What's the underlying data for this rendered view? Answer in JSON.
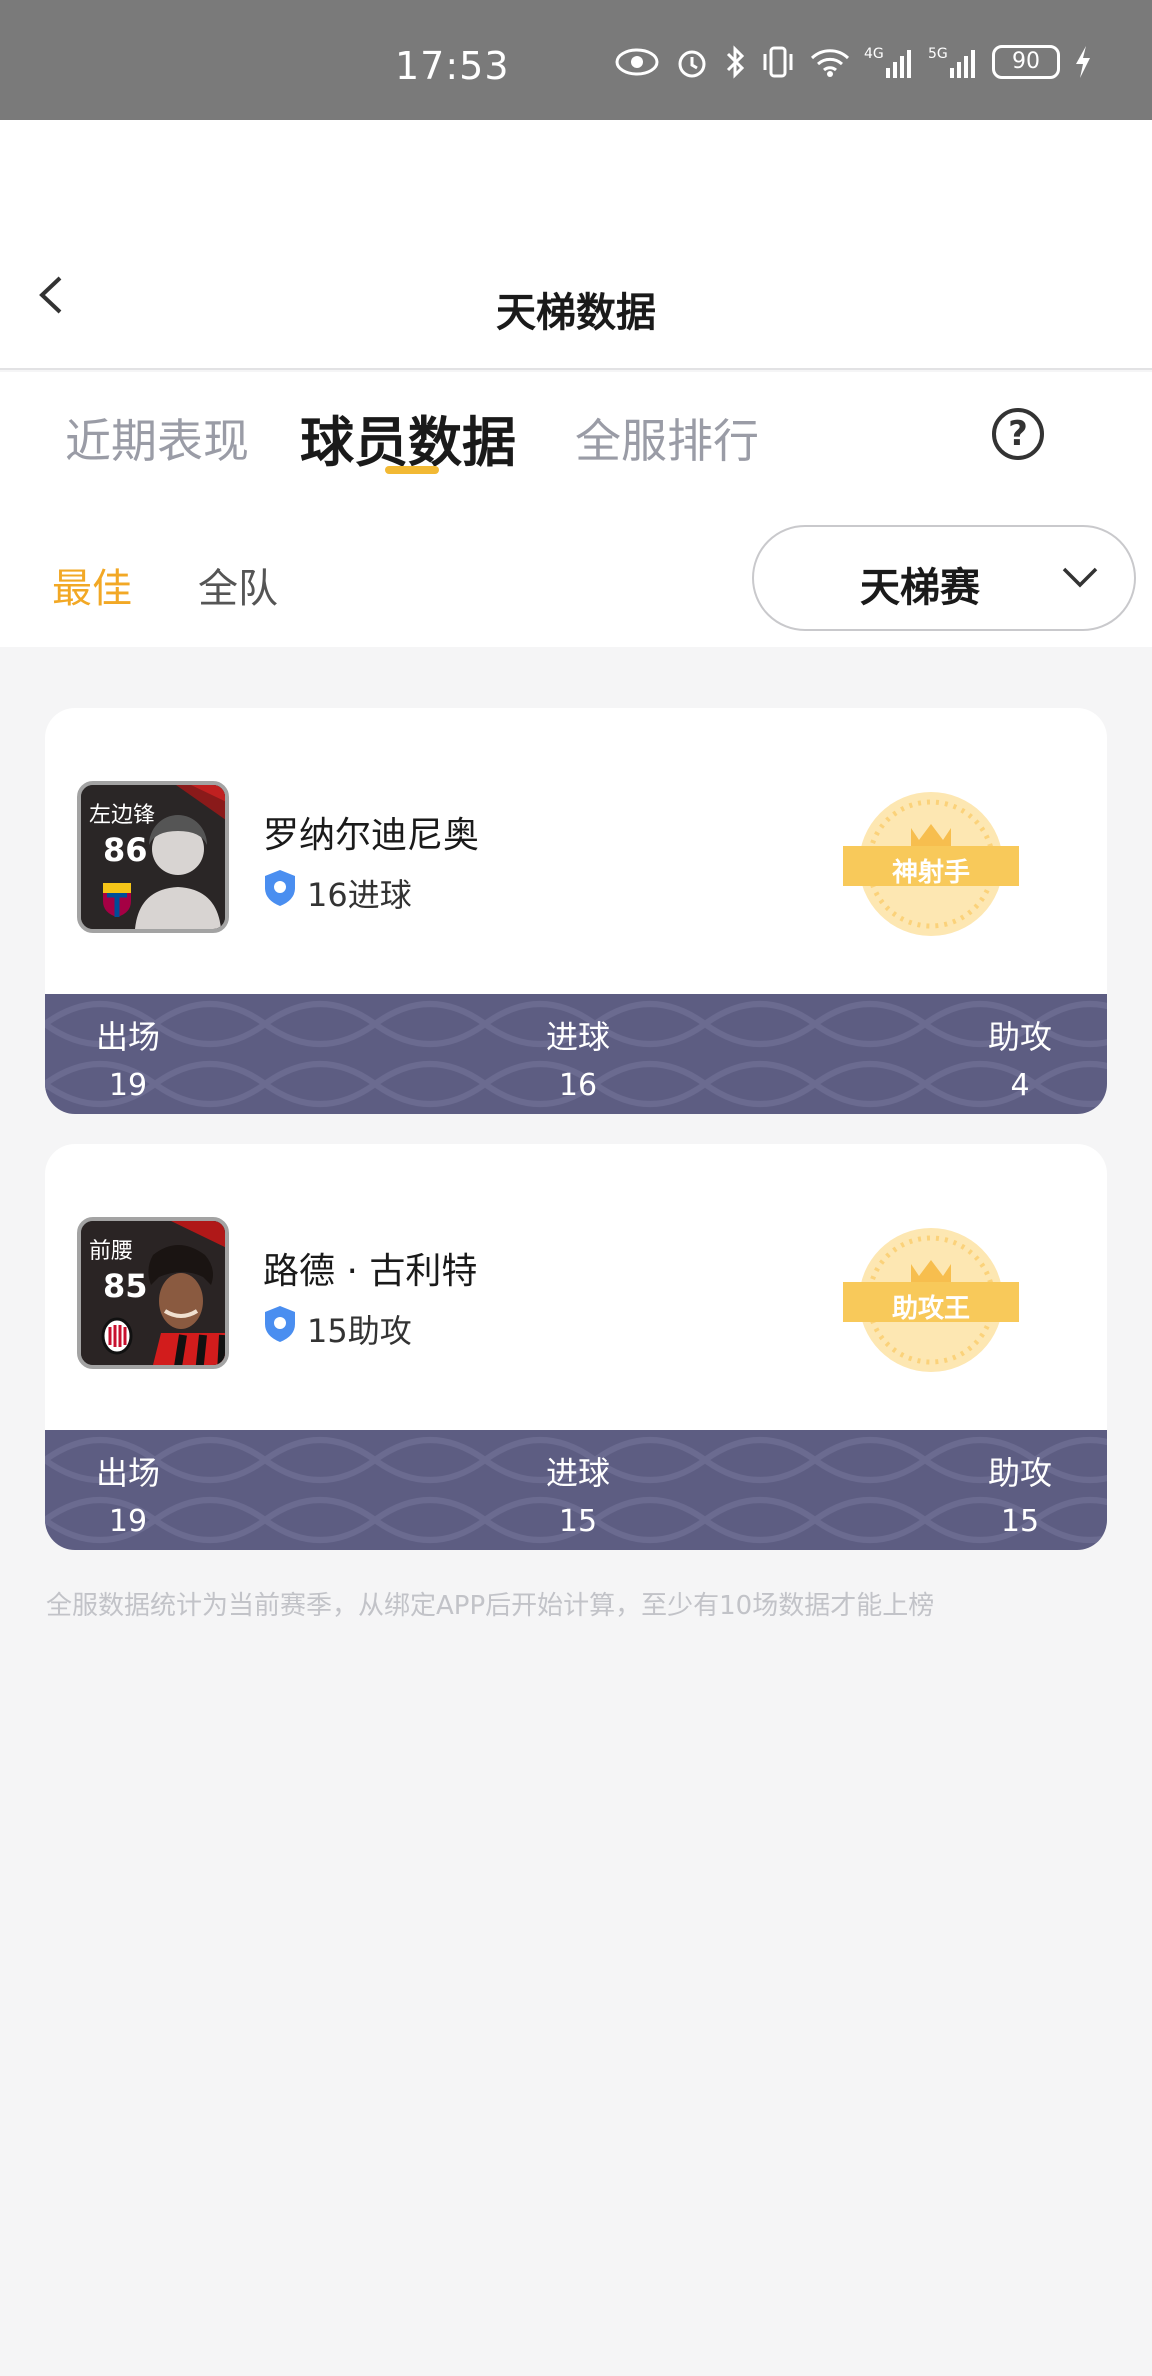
{
  "status_bar": {
    "time": "17:53",
    "battery": "90"
  },
  "header": {
    "title": "天梯数据"
  },
  "tabs": [
    {
      "label": "近期表现"
    },
    {
      "label": "球员数据"
    },
    {
      "label": "全服排行"
    }
  ],
  "filter": {
    "best": "最佳",
    "all": "全队",
    "mode": "天梯赛"
  },
  "players": [
    {
      "position": "左边锋",
      "rating": "86",
      "name": "罗纳尔迪尼奥",
      "highlight": "16进球",
      "honor": "神射手",
      "stats": {
        "apps_label": "出场",
        "apps": "19",
        "goals_label": "进球",
        "goals": "16",
        "assists_label": "助攻",
        "assists": "4"
      }
    },
    {
      "position": "前腰",
      "rating": "85",
      "name": "路德 · 古利特",
      "highlight": "15助攻",
      "honor": "助攻王",
      "stats": {
        "apps_label": "出场",
        "apps": "19",
        "goals_label": "进球",
        "goals": "15",
        "assists_label": "助攻",
        "assists": "15"
      }
    }
  ],
  "footnote": "全服数据统计为当前赛季，从绑定APP后开始计算，至少有10场数据才能上榜",
  "colors": {
    "accent": "#f2b934",
    "stats_bar": "#5d5d82",
    "honor": "#f8c95a"
  }
}
